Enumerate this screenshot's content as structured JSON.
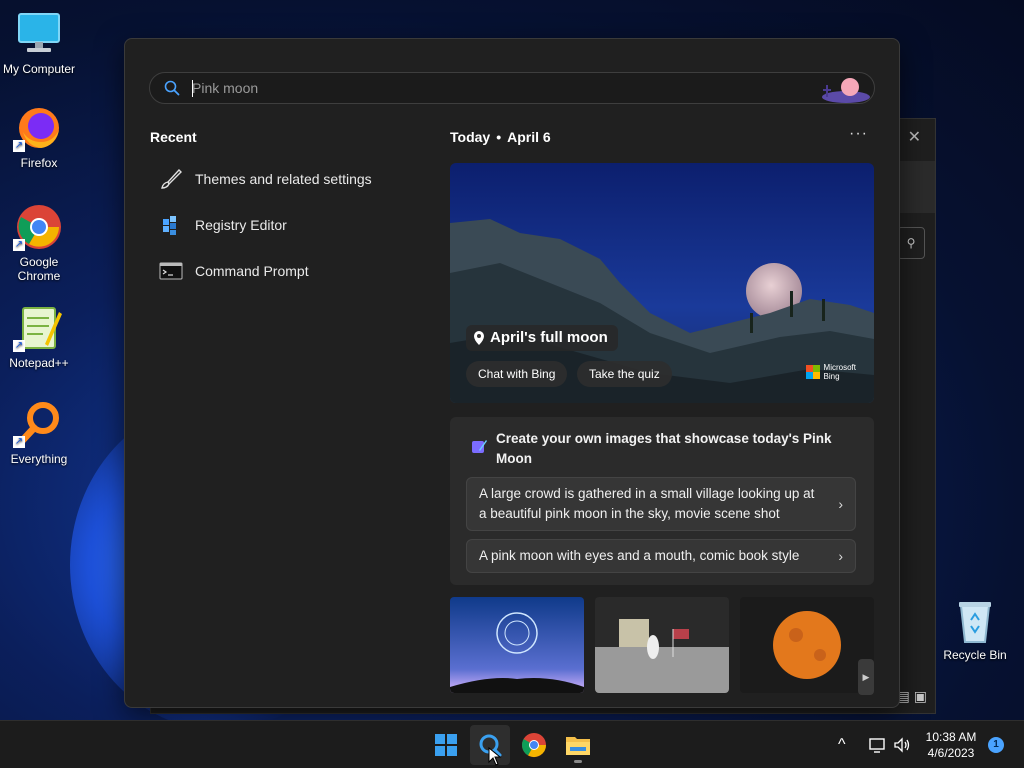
{
  "desktop": {
    "icons": [
      {
        "label": "My Computer"
      },
      {
        "label": "Firefox"
      },
      {
        "label": "Google Chrome"
      },
      {
        "label": "Notepad++"
      },
      {
        "label": "Everything"
      },
      {
        "label": "Recycle Bin"
      }
    ]
  },
  "search": {
    "placeholder": "Pink moon"
  },
  "recent": {
    "title": "Recent",
    "items": [
      {
        "label": "Themes and related settings",
        "icon": "brush-icon"
      },
      {
        "label": "Registry Editor",
        "icon": "registry-icon"
      },
      {
        "label": "Command Prompt",
        "icon": "terminal-icon"
      }
    ]
  },
  "highlights": {
    "today_label": "Today",
    "date": "April 6",
    "more_label": "···",
    "hero": {
      "title": "April's full moon",
      "chips": [
        "Chat with Bing",
        "Take the quiz"
      ],
      "brand": [
        "Microsoft",
        "Bing"
      ]
    },
    "create": {
      "title": "Create your own images that showcase today's Pink Moon",
      "prompts": [
        "A large crowd is gathered in a small village looking up at a beautiful pink moon in the sky, movie scene shot",
        "A pink moon with eyes and a mouth, comic book style"
      ],
      "chevron": "›"
    },
    "thumb_arrow": "▶"
  },
  "taskbar": {
    "time": "10:38 AM",
    "date": "4/6/2023",
    "notification_count": "1",
    "chevron": "^"
  },
  "colors": {
    "accent": "#4aa3ff",
    "panel_bg": "#202020",
    "card_bg": "#2b2b2b"
  }
}
